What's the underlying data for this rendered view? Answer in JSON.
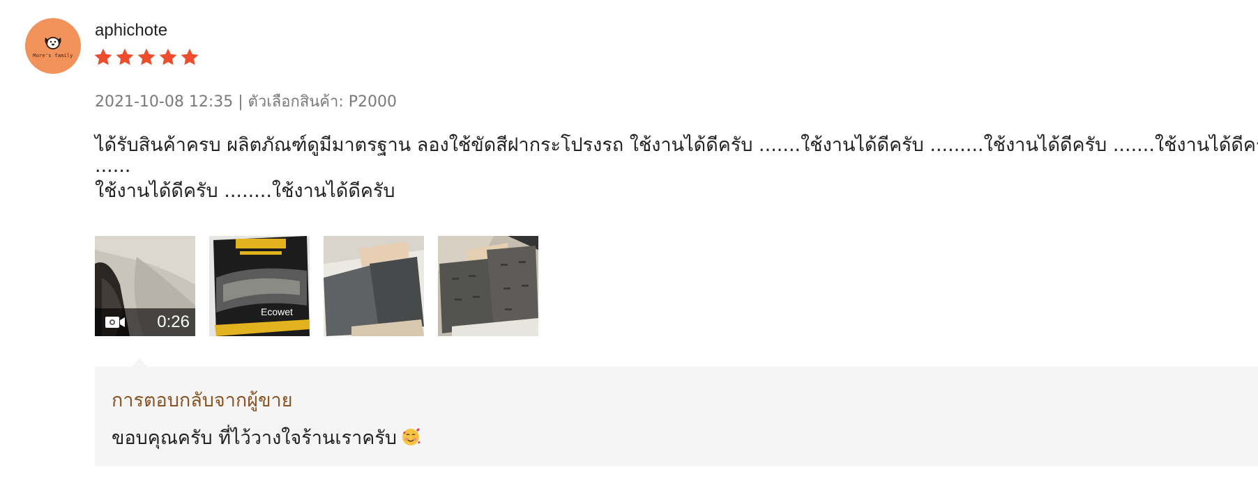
{
  "review": {
    "avatar": {
      "icon": "dog-face-icon",
      "text": "More's family",
      "bg_color": "#f0925a"
    },
    "username": "aphichote",
    "rating": 5,
    "star_color": "#ee4d2d",
    "meta": "2021-10-08 12:35 | ตัวเลือกสินค้า: P2000",
    "comment_lines": [
      "ได้รับสินค้าครบ ผลิตภัณฑ์ดูมีมาตรฐาน ลองใช้ขัดสีฝากระโปรงรถ ใช้งานได้ดีครับ .......ใช้งานได้ดีครับ .........ใช้งานได้ดีครับ .......ใช้งานได้ดีครับ",
      "......",
      "ใช้งานได้ดีครับ ........ใช้งานได้ดีครับ"
    ],
    "media": [
      {
        "type": "video",
        "duration": "0:26",
        "icon": "video-camera-icon"
      },
      {
        "type": "image",
        "label": "Ecowet"
      },
      {
        "type": "image"
      },
      {
        "type": "image"
      }
    ]
  },
  "seller_reply": {
    "title": "การตอบกลับจากผู้ขาย",
    "text": "ขอบคุณครับ ที่ไว้วางใจร้านเราครับ",
    "emoji": "smiling-face-with-hearts-icon",
    "title_color": "#8a5324"
  }
}
